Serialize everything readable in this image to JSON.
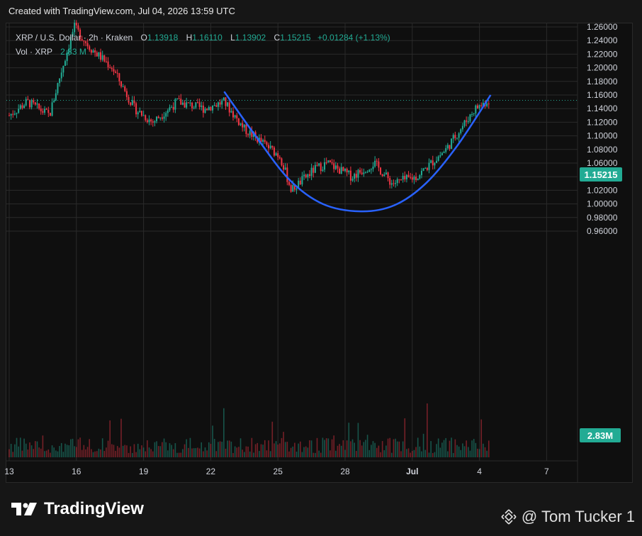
{
  "header": {
    "created": "Created with TradingView.com, Jul 04, 2026 13:59 UTC"
  },
  "legend": {
    "symbol": "XRP / U.S. Dollar · 2h · Kraken",
    "o_label": "O",
    "o": "1.13918",
    "h_label": "H",
    "h": "1.16110",
    "l_label": "L",
    "l": "1.13902",
    "c_label": "C",
    "c": "1.15215",
    "change": "+0.01284 (+1.13%)",
    "vol_label": "Vol · XRP",
    "vol": "2.83 M"
  },
  "badges": {
    "price": "1.15215",
    "volume": "2.83M"
  },
  "footer": {
    "brand": "TradingView",
    "user": "@ Tom Tucker 1"
  },
  "colors": {
    "up": "#22ab94",
    "down": "#f23645",
    "curve": "#2962ff",
    "bg": "#0f0f0f",
    "grid": "#2a2a2a"
  },
  "chart_data": {
    "type": "candlestick",
    "y_ticks": [
      "1.26000",
      "1.24000",
      "1.22000",
      "1.20000",
      "1.18000",
      "1.16000",
      "1.14000",
      "1.12000",
      "1.10000",
      "1.08000",
      "1.06000",
      "1.04000",
      "1.02000",
      "1.00000",
      "0.98000",
      "0.96000"
    ],
    "x_ticks": [
      "13",
      "16",
      "19",
      "22",
      "25",
      "28",
      "Jul",
      "4",
      "7"
    ],
    "ylim": [
      0.955,
      1.265
    ],
    "last_price": 1.15215,
    "key_closes": [
      {
        "day": 13.0,
        "v": 1.13
      },
      {
        "day": 13.8,
        "v": 1.15
      },
      {
        "day": 14.8,
        "v": 1.13
      },
      {
        "day": 15.2,
        "v": 1.18
      },
      {
        "day": 15.9,
        "v": 1.26
      },
      {
        "day": 16.6,
        "v": 1.23
      },
      {
        "day": 17.6,
        "v": 1.2
      },
      {
        "day": 18.6,
        "v": 1.14
      },
      {
        "day": 19.4,
        "v": 1.12
      },
      {
        "day": 20.5,
        "v": 1.15
      },
      {
        "day": 21.7,
        "v": 1.14
      },
      {
        "day": 22.6,
        "v": 1.15
      },
      {
        "day": 23.5,
        "v": 1.11
      },
      {
        "day": 24.3,
        "v": 1.09
      },
      {
        "day": 25.1,
        "v": 1.07
      },
      {
        "day": 25.6,
        "v": 1.02
      },
      {
        "day": 26.6,
        "v": 1.05
      },
      {
        "day": 27.2,
        "v": 1.06
      },
      {
        "day": 28.3,
        "v": 1.04
      },
      {
        "day": 29.3,
        "v": 1.06
      },
      {
        "day": 30.1,
        "v": 1.03
      },
      {
        "day": 31.2,
        "v": 1.04
      },
      {
        "day": 32.5,
        "v": 1.08
      },
      {
        "day": 33.8,
        "v": 1.14
      },
      {
        "day": 34.4,
        "v": 1.152
      }
    ],
    "cup_curve": [
      {
        "day": 22.6,
        "v": 1.165
      },
      {
        "day": 24.0,
        "v": 1.1
      },
      {
        "day": 25.5,
        "v": 1.036
      },
      {
        "day": 27.0,
        "v": 1.0
      },
      {
        "day": 28.7,
        "v": 0.989
      },
      {
        "day": 30.2,
        "v": 0.998
      },
      {
        "day": 31.6,
        "v": 1.03
      },
      {
        "day": 33.0,
        "v": 1.085
      },
      {
        "day": 34.5,
        "v": 1.16
      }
    ]
  }
}
